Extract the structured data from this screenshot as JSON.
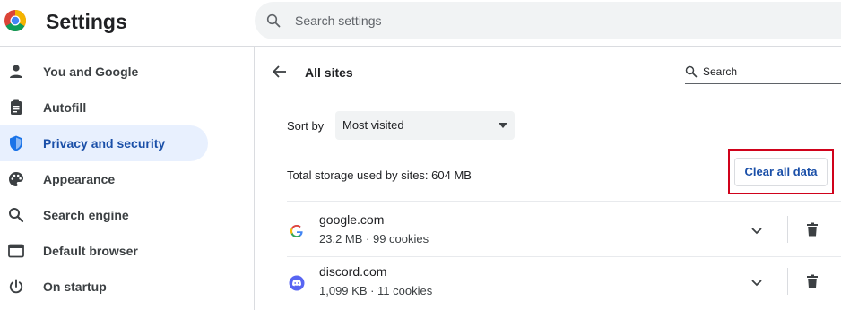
{
  "header": {
    "title": "Settings",
    "search_placeholder": "Search settings",
    "logo_icon": "chrome-logo-icon",
    "search_icon": "search-icon"
  },
  "sidebar": {
    "items": [
      {
        "label": "You and Google",
        "icon": "person-icon",
        "active": false
      },
      {
        "label": "Autofill",
        "icon": "clipboard-icon",
        "active": false
      },
      {
        "label": "Privacy and security",
        "icon": "shield-icon",
        "active": true
      },
      {
        "label": "Appearance",
        "icon": "palette-icon",
        "active": false
      },
      {
        "label": "Search engine",
        "icon": "search-icon",
        "active": false
      },
      {
        "label": "Default browser",
        "icon": "browser-icon",
        "active": false
      },
      {
        "label": "On startup",
        "icon": "power-icon",
        "active": false
      }
    ]
  },
  "main": {
    "title": "All sites",
    "search_label": "Search",
    "sort_label": "Sort by",
    "sort_value": "Most visited",
    "storage_text": "Total storage used by sites: 604 MB",
    "clear_button": "Clear all data",
    "sites": [
      {
        "name": "google.com",
        "meta": "23.2 MB · 99 cookies",
        "icon": "google-favicon-icon"
      },
      {
        "name": "discord.com",
        "meta": "1,099 KB · 11 cookies",
        "icon": "discord-favicon-icon"
      }
    ]
  },
  "colors": {
    "accent": "#1a4fa8",
    "active_bg": "#e8f0fe",
    "highlight_border": "#d0021b",
    "search_bg": "#f1f3f4"
  }
}
